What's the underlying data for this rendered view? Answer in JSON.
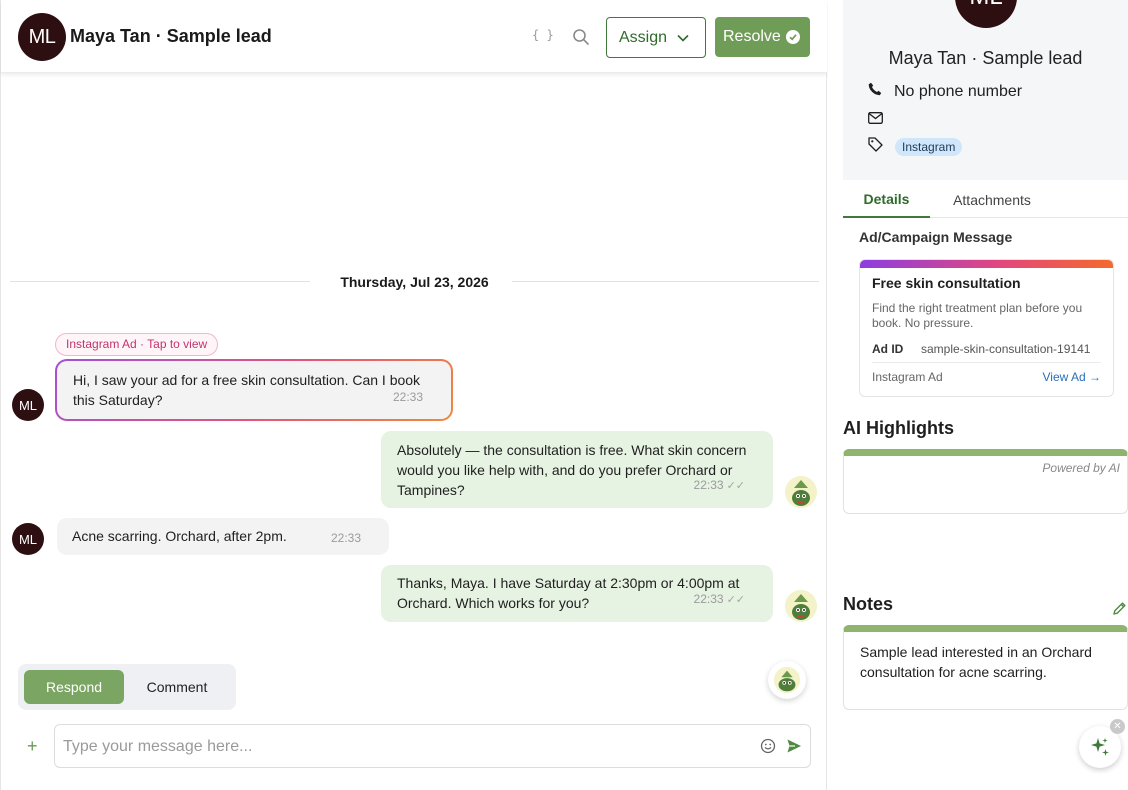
{
  "header": {
    "avatar_initials": "ML",
    "title": "Maya Tan · Sample lead",
    "braces_icon_text": "{ }",
    "assign_label": "Assign",
    "resolve_label": "Resolve"
  },
  "conversation": {
    "date_label": "Thursday, Jul 23, 2026",
    "ad_chip_label": "Instagram Ad · Tap to view",
    "contact_initials": "ML",
    "messages": [
      {
        "from": "contact",
        "text": "Hi, I saw your ad for a free skin consultation. Can I book this Saturday?",
        "time": "22:33"
      },
      {
        "from": "agent",
        "text": "Absolutely — the consultation is free. What skin concern would you like help with, and do you prefer Orchard or Tampines?",
        "time": "22:33",
        "ticks": "✓✓"
      },
      {
        "from": "contact",
        "text": "Acne scarring. Orchard, after 2pm.",
        "time": "22:33"
      },
      {
        "from": "agent",
        "text": "Thanks, Maya. I have Saturday at 2:30pm or 4:00pm at Orchard. Which works for you?",
        "time": "22:33",
        "ticks": "✓✓"
      }
    ]
  },
  "composer": {
    "respond_label": "Respond",
    "comment_label": "Comment",
    "plus_label": "+",
    "placeholder": "Type your message here..."
  },
  "contact": {
    "initials": "ML",
    "name": "Maya Tan · Sample lead",
    "phone": "No phone number",
    "email": "",
    "tags": [
      "Instagram"
    ]
  },
  "side_tabs": {
    "details": "Details",
    "attachments": "Attachments"
  },
  "ad_campaign": {
    "section_title": "Ad/Campaign Message",
    "title": "Free skin consultation",
    "description": "Find the right treatment plan before you book. No pressure.",
    "ad_id_label": "Ad ID",
    "ad_id_value": "sample-skin-consultation-19141",
    "source": "Instagram Ad",
    "view_link": "View Ad →"
  },
  "ai_highlights": {
    "title": "AI Highlights",
    "powered_by": "Powered by AI"
  },
  "notes": {
    "title": "Notes",
    "text": "Sample lead interested in an Orchard consultation for acne scarring."
  },
  "colors": {
    "brand_green": "#6f9d58",
    "dark_avatar": "#2d0f11",
    "agent_bubble": "#e6f2e2",
    "contact_bubble": "#f3f3f4"
  }
}
